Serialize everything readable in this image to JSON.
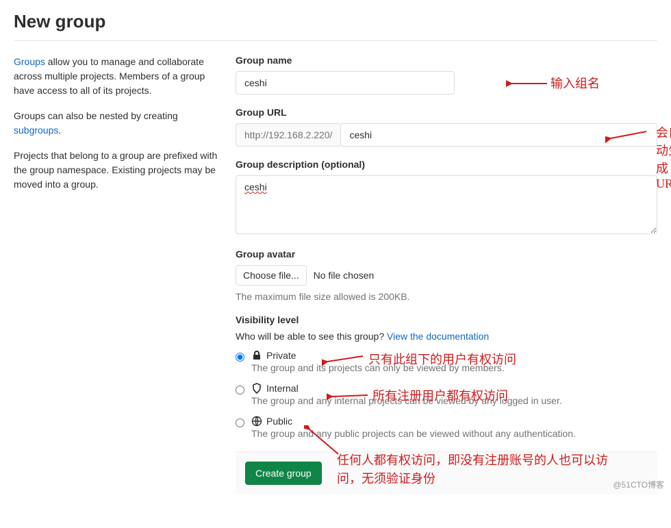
{
  "page_title": "New group",
  "side": {
    "p1_link": "Groups",
    "p1_rest": " allow you to manage and collaborate across multiple projects. Members of a group have access to all of its projects.",
    "p2_pre": "Groups can also be nested by creating ",
    "p2_link": "subgroups",
    "p2_post": ".",
    "p3": "Projects that belong to a group are prefixed with the group namespace. Existing projects may be moved into a group."
  },
  "form": {
    "name_label": "Group name",
    "name_value": "ceshi",
    "url_label": "Group URL",
    "url_prefix": "http://192.168.2.220/",
    "url_value": "ceshi",
    "desc_label": "Group description (optional)",
    "desc_value": "ceshi",
    "avatar_label": "Group avatar",
    "choose_file": "Choose file...",
    "no_file": "No file chosen",
    "avatar_hint": "The maximum file size allowed is 200KB.",
    "vis_label": "Visibility level",
    "vis_sub_pre": "Who will be able to see this group? ",
    "vis_sub_link": "View the documentation",
    "vis": [
      {
        "key": "private",
        "title": "Private",
        "desc": "The group and its projects can only be viewed by members.",
        "checked": true
      },
      {
        "key": "internal",
        "title": "Internal",
        "desc": "The group and any internal projects can be viewed by any logged in user.",
        "checked": false
      },
      {
        "key": "public",
        "title": "Public",
        "desc": "The group and any public projects can be viewed without any authentication.",
        "checked": false
      }
    ],
    "submit": "Create group"
  },
  "annotations": {
    "a1": "输入组名",
    "a2": "会自动生成URL",
    "a3": "只有此组下的用户有权访问",
    "a4": "所有注册用户都有权访问",
    "a5": "任何人都有权访问，即没有注册账号的人也可以访问，无须验证身份"
  },
  "watermark": "@51CTO博客"
}
